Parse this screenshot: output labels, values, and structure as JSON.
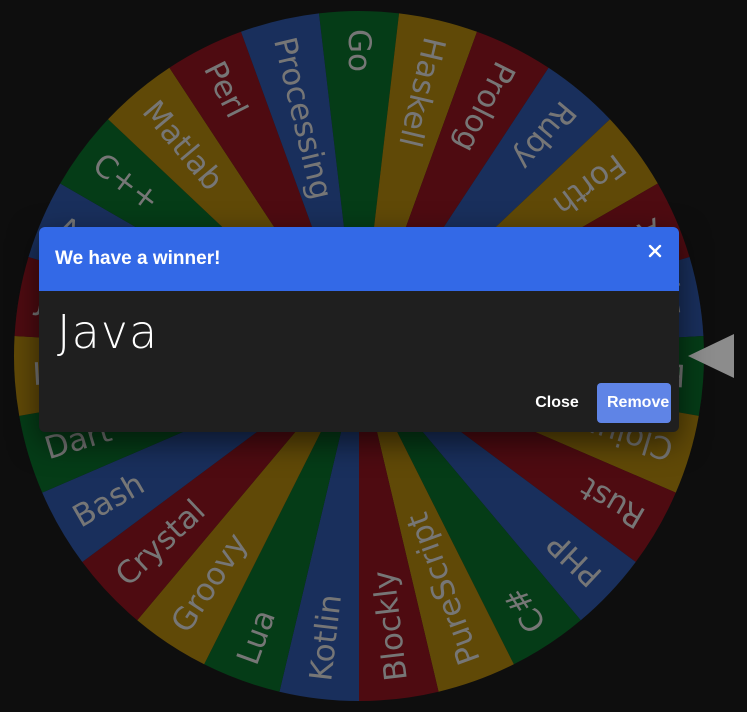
{
  "wheel": {
    "segments": [
      {
        "label": "Go",
        "color": "#0a6e2a"
      },
      {
        "label": "Haskell",
        "color": "#b0850e"
      },
      {
        "label": "Prolog",
        "color": "#8e1420"
      },
      {
        "label": "Ruby",
        "color": "#2e57a8"
      },
      {
        "label": "Forth",
        "color": "#b0850e"
      },
      {
        "label": "Ada",
        "color": "#8e1420"
      },
      {
        "label": "Java",
        "color": "#2e57a8"
      },
      {
        "label": "Elixir",
        "color": "#0a6e2a"
      },
      {
        "label": "Clojure",
        "color": "#b0850e"
      },
      {
        "label": "Rust",
        "color": "#8e1420"
      },
      {
        "label": "PHP",
        "color": "#2e57a8"
      },
      {
        "label": "C#",
        "color": "#0a6e2a"
      },
      {
        "label": "PureScript",
        "color": "#b0850e"
      },
      {
        "label": "Blockly",
        "color": "#8e1420"
      },
      {
        "label": "Kotlin",
        "color": "#2e57a8"
      },
      {
        "label": "Lua",
        "color": "#0a6e2a"
      },
      {
        "label": "Groovy",
        "color": "#b0850e"
      },
      {
        "label": "Crystal",
        "color": "#8e1420"
      },
      {
        "label": "Bash",
        "color": "#2e57a8"
      },
      {
        "label": "Dart",
        "color": "#0a6e2a"
      },
      {
        "label": "Lisp",
        "color": "#b0850e"
      },
      {
        "label": "Java",
        "color": "#8e1420"
      },
      {
        "label": "Assembly",
        "color": "#2e57a8"
      },
      {
        "label": "C++",
        "color": "#0a6e2a"
      },
      {
        "label": "Matlab",
        "color": "#b0850e"
      },
      {
        "label": "Perl",
        "color": "#8e1420"
      },
      {
        "label": "Processing",
        "color": "#2e57a8"
      }
    ],
    "text_color": "#d8d8d8",
    "dim_overlay": "rgba(0,0,0,0.45)",
    "pointer_color": "#8c8c8c"
  },
  "dialog": {
    "title": "We have a winner!",
    "winner": "Java",
    "close_label": "Close",
    "remove_label": "Remove",
    "header_color": "#3369e7"
  }
}
